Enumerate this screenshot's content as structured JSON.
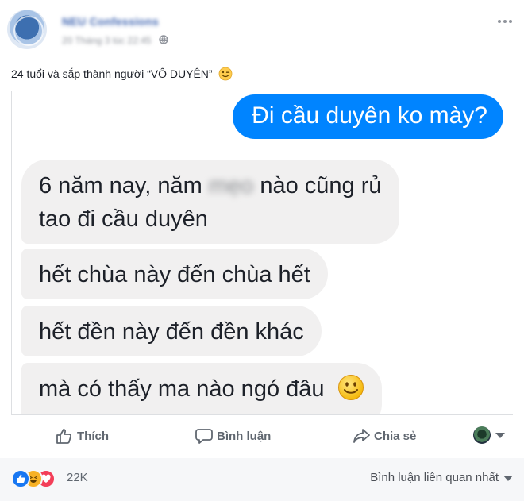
{
  "header": {
    "page_name": "NEU Confessions",
    "timestamp": "20 Tháng 3 lúc 22:45",
    "privacy_icon": "globe-icon",
    "more_icon": "more-options-icon"
  },
  "post": {
    "text": "24 tuổi và sắp thành người “VÔ DUYÊN”",
    "emoji": "wink-emoji"
  },
  "chat": {
    "outgoing": "Đi cầu duyên ko mày?",
    "incoming": [
      {
        "line1_before": "6 năm nay, năm ",
        "censored": "mẹo",
        "line1_after": " nào cũng rủ",
        "line2": "tao đi cầu duyên"
      },
      {
        "text": "hết chùa này đến chùa hết"
      },
      {
        "text": "hết đền này đến đền khác"
      },
      {
        "text": "mà có thấy ma nào ngó đâu",
        "emoji": "smile-emoji"
      }
    ],
    "colors": {
      "outgoing_bubble": "#0084ff",
      "incoming_bubble": "#f1f0f0"
    }
  },
  "actions": {
    "like": "Thích",
    "comment": "Bình luận",
    "share": "Chia sẻ"
  },
  "footer": {
    "reaction_count": "22K",
    "reactions": [
      "like",
      "haha",
      "love"
    ],
    "sort_label": "Bình luận liên quan nhất"
  }
}
